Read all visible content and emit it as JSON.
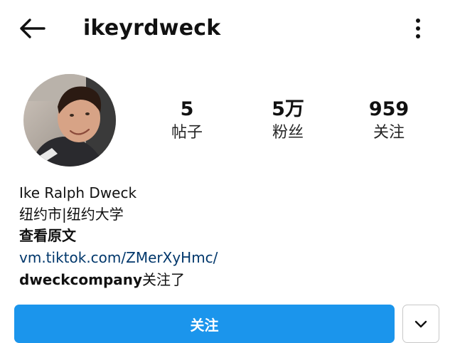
{
  "header": {
    "username": "ikeyrdweck",
    "back_icon": "arrow-left-icon",
    "more_icon": "vertical-ellipsis-icon"
  },
  "profile": {
    "avatar": "profile-photo",
    "stats": [
      {
        "value": "5",
        "label": "帖子"
      },
      {
        "value": "5万",
        "label": "粉丝"
      },
      {
        "value": "959",
        "label": "关注"
      }
    ]
  },
  "bio": {
    "name": "Ike Ralph Dweck",
    "location": "纽约市|纽约大学",
    "see_translation": "查看原文",
    "link": "vm.tiktok.com/ZMerXyHmc/",
    "followed_by_user": "dweckcompany",
    "followed_by_suffix": "关注了"
  },
  "actions": {
    "follow_label": "关注",
    "dropdown_icon": "chevron-down-icon",
    "follow_color": "#1b95ec"
  }
}
